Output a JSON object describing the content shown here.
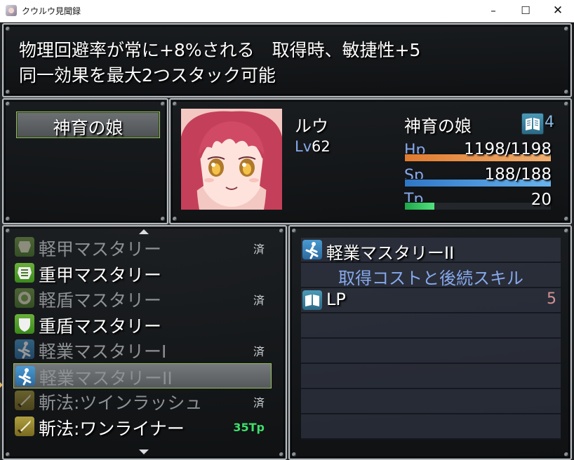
{
  "window": {
    "title": "クウルウ見聞録",
    "minimize_glyph": "–",
    "maximize_glyph": "☐",
    "close_glyph": "✕"
  },
  "help": {
    "lines": [
      "物理回避率が常に+8%される　取得時、敏捷性+5",
      "同一効果を最大2つスタック可能"
    ]
  },
  "class_window": {
    "selected_class": "神育の娘"
  },
  "actor": {
    "name": "ルウ",
    "level_label": "Lv",
    "level": "62",
    "class": "神育の娘",
    "skill_points": "4",
    "hp": {
      "label": "Hp",
      "value": "1198/1198",
      "ratio": 1.0,
      "color_from": "#e07a30",
      "color_to": "#f0b070"
    },
    "sp": {
      "label": "Sp",
      "value": "188/188",
      "ratio": 1.0,
      "color_from": "#2f76c6",
      "color_to": "#6ab4ee"
    },
    "tp": {
      "label": "Tp",
      "value": "20",
      "ratio": 0.2,
      "color_from": "#1fa64a",
      "color_to": "#52e27e"
    }
  },
  "skill_list": {
    "items": [
      {
        "name": "軽甲マスタリー",
        "status": "済",
        "cost": "",
        "learned": true,
        "icon": "light-armor-icon"
      },
      {
        "name": "重甲マスタリー",
        "status": "",
        "cost": "",
        "learned": false,
        "icon": "heavy-armor-icon"
      },
      {
        "name": "軽盾マスタリー",
        "status": "済",
        "cost": "",
        "learned": true,
        "icon": "light-shield-icon"
      },
      {
        "name": "重盾マスタリー",
        "status": "",
        "cost": "",
        "learned": false,
        "icon": "heavy-shield-icon"
      },
      {
        "name": "軽業マスタリーI",
        "status": "済",
        "cost": "",
        "learned": true,
        "icon": "acrobat-icon"
      },
      {
        "name": "軽業マスタリーII",
        "status": "",
        "cost": "",
        "learned": false,
        "icon": "acrobat-icon"
      },
      {
        "name": "斬法:ツインラッシュ",
        "status": "済",
        "cost": "",
        "learned": true,
        "icon": "sword-icon"
      },
      {
        "name": "斬法:ワンライナー",
        "status": "",
        "cost": "35Tp",
        "learned": false,
        "icon": "sword-icon"
      }
    ]
  },
  "detail": {
    "skill_name": "軽業マスタリーII",
    "header": "取得コストと後続スキル",
    "cost_label": "LP",
    "cost_value": "5"
  }
}
